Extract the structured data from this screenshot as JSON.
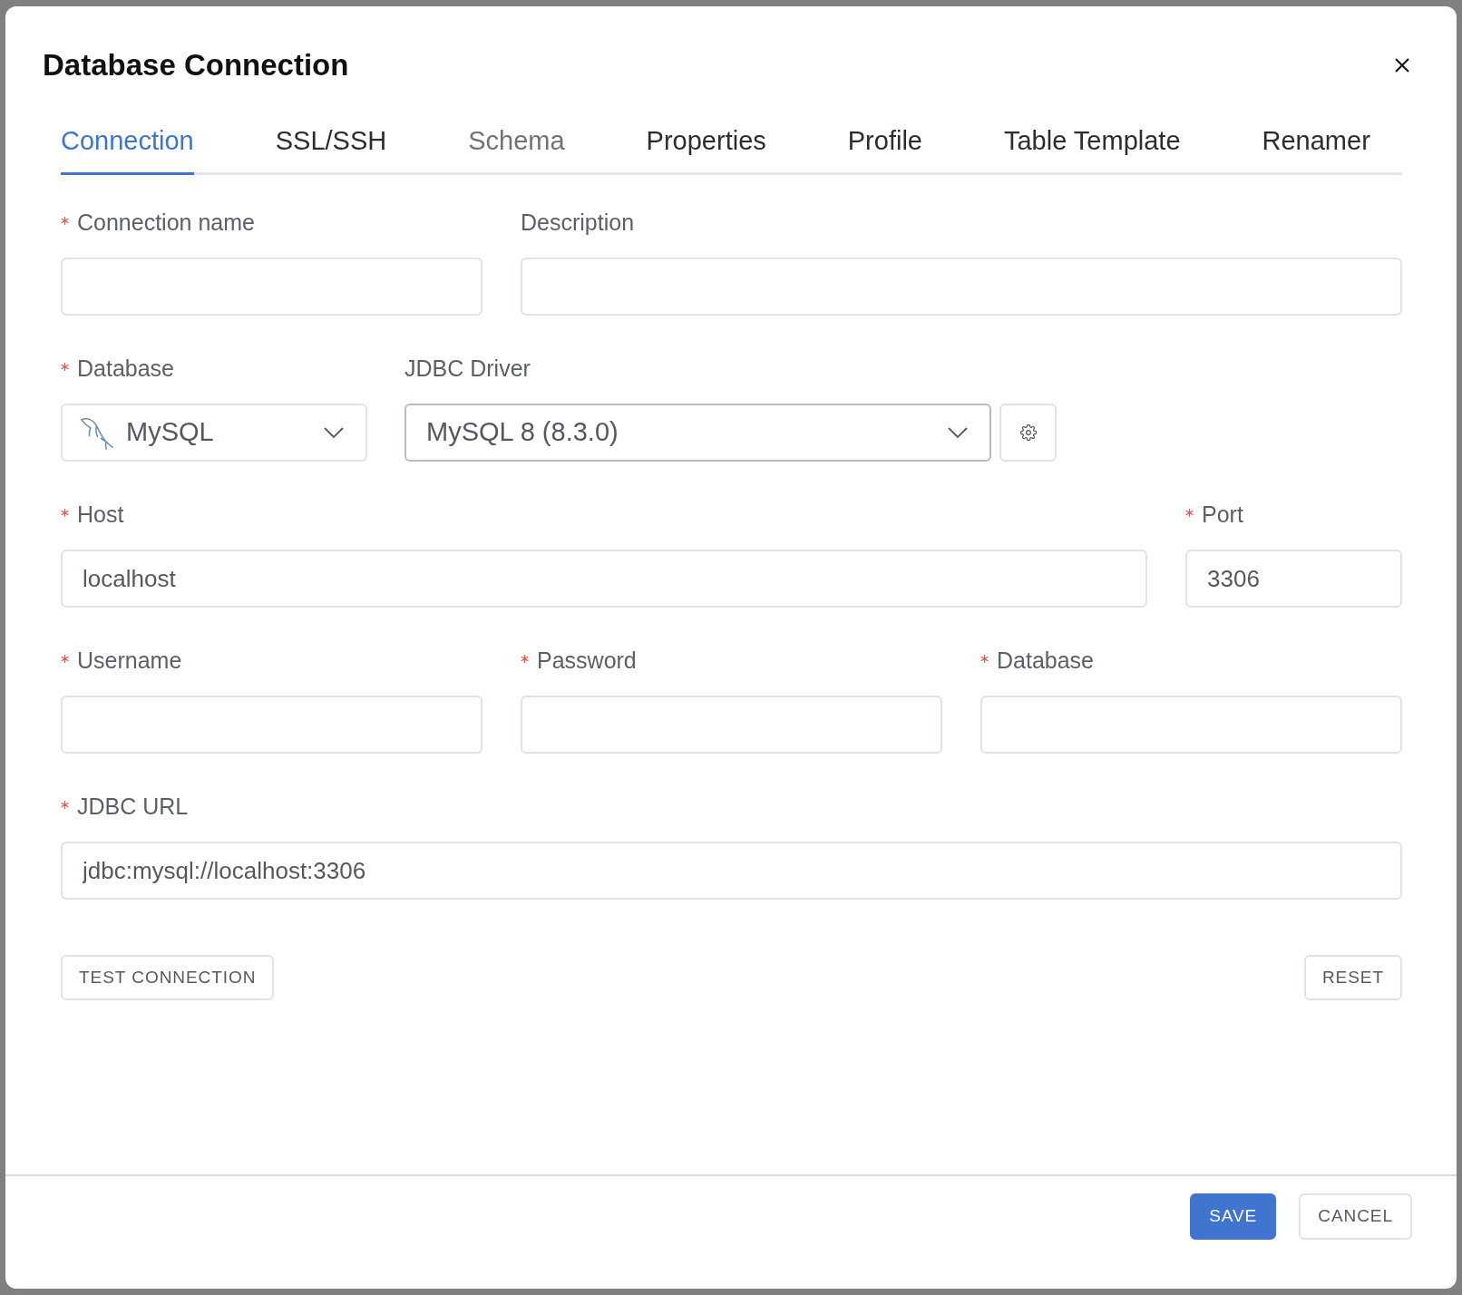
{
  "dialog": {
    "title": "Database Connection"
  },
  "tabs": [
    {
      "label": "Connection",
      "selected": true,
      "disabled": false
    },
    {
      "label": "SSL/SSH",
      "selected": false,
      "disabled": false
    },
    {
      "label": "Schema",
      "selected": false,
      "disabled": true
    },
    {
      "label": "Properties",
      "selected": false,
      "disabled": false
    },
    {
      "label": "Profile",
      "selected": false,
      "disabled": false
    },
    {
      "label": "Table Template",
      "selected": false,
      "disabled": false
    },
    {
      "label": "Renamer",
      "selected": false,
      "disabled": false
    }
  ],
  "fields": {
    "connection_name": {
      "kind": "input",
      "label": "Connection name",
      "required": true
    },
    "description": {
      "kind": "input",
      "label": "Description",
      "required": false
    },
    "database": {
      "kind": "select",
      "label": "Database",
      "required": true,
      "value": "MySQL",
      "focused": false
    },
    "jdbc_driver": {
      "kind": "select",
      "label": "JDBC Driver",
      "required": false,
      "value": "MySQL 8 (8.3.0)",
      "focused": true
    },
    "host": {
      "kind": "input",
      "label": "Host",
      "required": true,
      "value": "localhost"
    },
    "port": {
      "kind": "input",
      "label": "Port",
      "required": true,
      "value": "3306"
    },
    "username": {
      "kind": "input",
      "label": "Username",
      "required": true
    },
    "password": {
      "kind": "password",
      "label": "Password",
      "required": true
    },
    "database_name": {
      "kind": "input",
      "label": "Database",
      "required": true
    },
    "jdbc_url": {
      "kind": "input",
      "label": "JDBC URL",
      "required": true,
      "value": "jdbc:mysql://localhost:3306"
    }
  },
  "form_actions": {
    "test": "TEST CONNECTION",
    "reset": "RESET"
  },
  "footer": {
    "buttons": [
      {
        "label": "SAVE",
        "kind": "primary"
      },
      {
        "label": "CANCEL",
        "kind": "secondary"
      }
    ]
  }
}
